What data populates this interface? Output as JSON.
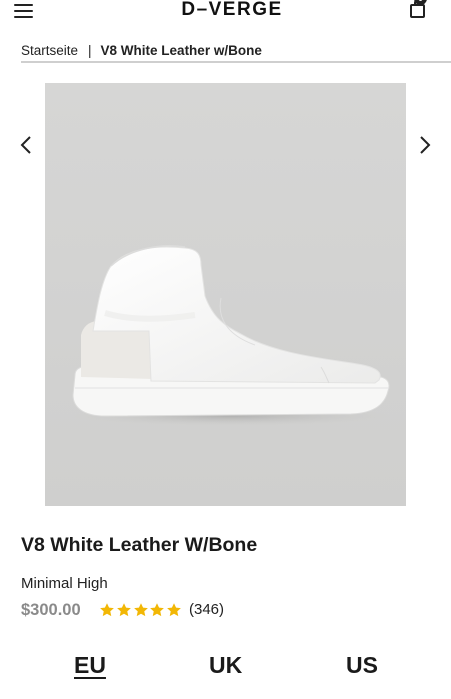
{
  "header": {
    "brand": "D–VERGE",
    "cart_count": "0"
  },
  "breadcrumb": {
    "home_label": "Startseite",
    "separator": "|",
    "current_label": "V8 White Leather w/Bone"
  },
  "gallery": {
    "image_description_icon": "product-photo",
    "prev_icon": "chevron-left-icon",
    "next_icon": "chevron-right-icon"
  },
  "product": {
    "title": "V8 White Leather W/Bone",
    "subtitle": "Minimal High",
    "price": "$300.00",
    "rating": {
      "stars": 5,
      "count_label": "(346)",
      "star_color": "#f2b705"
    }
  },
  "size_systems": {
    "tabs": [
      {
        "label": "EU",
        "active": true
      },
      {
        "label": "UK",
        "active": false
      },
      {
        "label": "US",
        "active": false
      }
    ]
  }
}
